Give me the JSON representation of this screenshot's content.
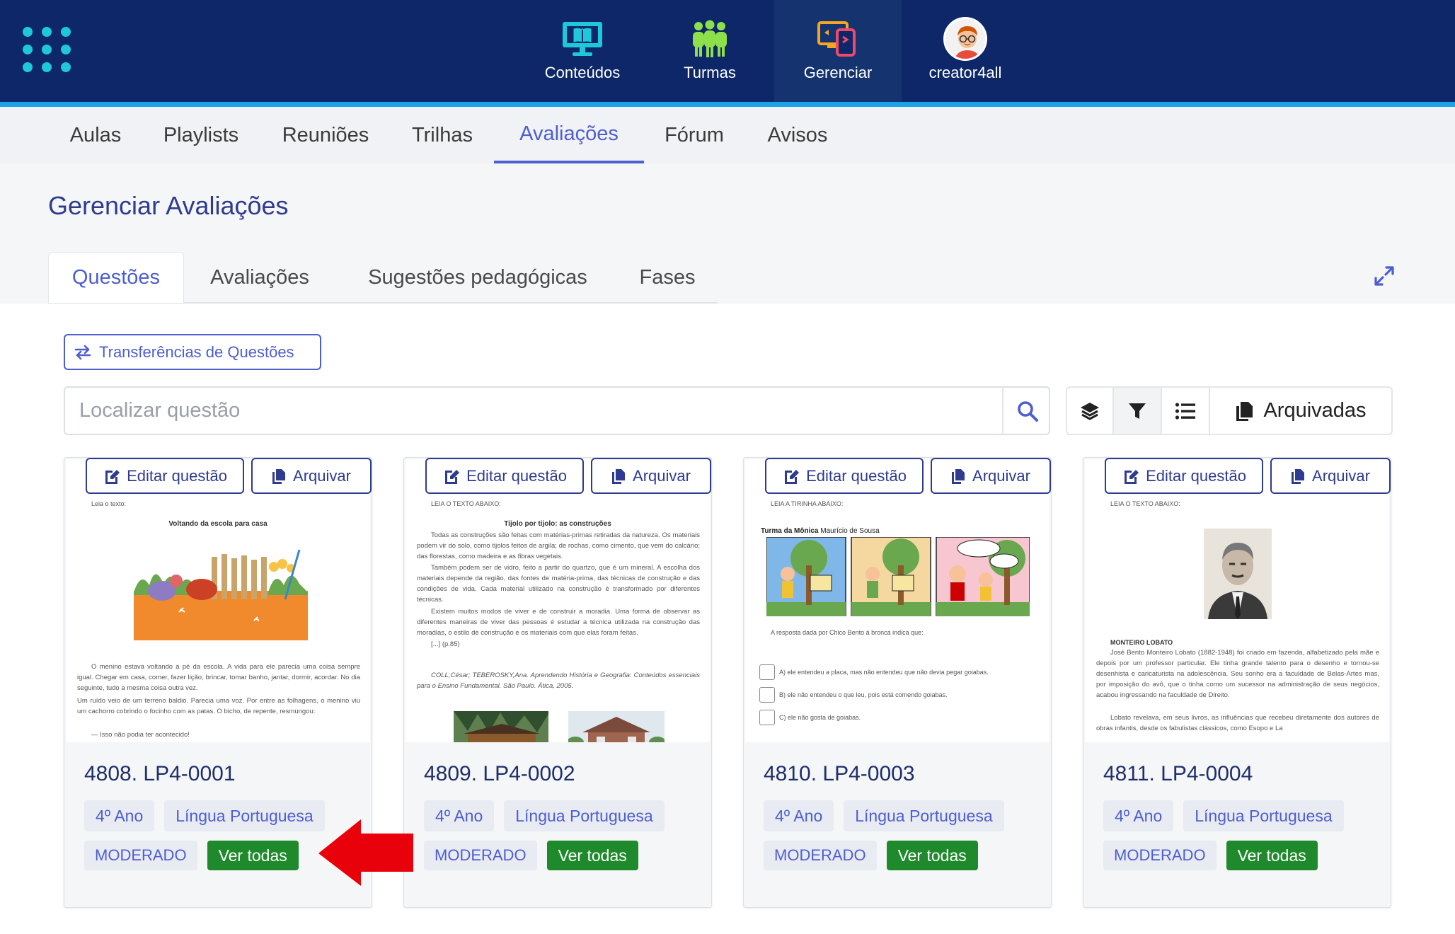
{
  "topnav": {
    "items": [
      {
        "label": "Conteúdos",
        "icon": "monitor-icon"
      },
      {
        "label": "Turmas",
        "icon": "people-icon"
      },
      {
        "label": "Gerenciar",
        "icon": "devices-icon",
        "active": true
      },
      {
        "label": "creator4all",
        "icon": "avatar"
      }
    ]
  },
  "subnav": {
    "items": [
      "Aulas",
      "Playlists",
      "Reuniões",
      "Trilhas",
      "Avaliações",
      "Fórum",
      "Avisos"
    ],
    "active": "Avaliações"
  },
  "page": {
    "title": "Gerenciar Avaliações",
    "tabs": [
      "Questões",
      "Avaliações",
      "Sugestões pedagógicas",
      "Fases"
    ],
    "active_tab": "Questões"
  },
  "transfer_button": {
    "label": "Transferências de Questões",
    "icon": "swap-icon"
  },
  "search": {
    "placeholder": "Localizar questão",
    "value": ""
  },
  "toolbar": {
    "archived_label": "Arquivadas"
  },
  "card_buttons": {
    "edit": "Editar questão",
    "archive": "Arquivar",
    "view_all": "Ver todas"
  },
  "cards": [
    {
      "code": "4808. LP4-0001",
      "grade": "4º Ano",
      "subject": "Língua Portuguesa",
      "status": "MODERADO",
      "preview": {
        "heading": "Leia o texto:",
        "title": "Voltando da escola para casa",
        "para1": "O menino estava voltando a pé da escola. A vida para ele parecia uma coisa sempre igual. Chegar em casa, comer, fazer lição, brincar, tomar banho, jantar, dormir, acordar. No dia seguinte, tudo a mesma coisa outra vez.",
        "para2": "Um ruído veio de um terreno baldio. Parecia uma voz. Por entre as folhagens, o menino viu um cachorro cobrindo o focinho com as patas. O bicho, de repente, resmungou:",
        "para3": "— Isso não podia ter acontecido!"
      }
    },
    {
      "code": "4809. LP4-0002",
      "grade": "4º Ano",
      "subject": "Língua Portuguesa",
      "status": "MODERADO",
      "preview": {
        "heading": "LEIA O TEXTO ABAIXO:",
        "title": "Tijolo por tijolo: as construções",
        "para1": "Todas as construções são feitas com matérias-primas retiradas da natureza. Os materiais podem vir do solo, como tijolos feitos de argila; de rochas, como cimento, que vem do calcário; das florestas, como madeira e as fibras vegetais.",
        "para2": "Também podem ser de vidro, feito a partir do quartzo, que é um mineral. A escolha dos materiais depende da região, das fontes de matéria-prima, das técnicas de construção e das condições de vida. Cada material utilizado na construção é transformado por diferentes técnicas.",
        "para3": "Existem muitos modos de viver e de construir a moradia. Uma forma de observar as diferentes maneiras de viver das pessoas é estudar a técnica utilizada na construção das moradias, o estilo de construção e os materiais com que elas foram feitas.",
        "para4": "[...] (p.85)",
        "citation": "COLL,César; TEBEROSKY,Ana. Aprendendo História e Geografia: Conteúdos essenciais para o Ensino Fundamental. São Paulo. Ática, 2005."
      }
    },
    {
      "code": "4810. LP4-0003",
      "grade": "4º Ano",
      "subject": "Língua Portuguesa",
      "status": "MODERADO",
      "preview": {
        "heading": "LEIA A TIRINHA ABAIXO:",
        "comic_title_bold": "Turma da Mônica",
        "comic_title_author": "Maurício de Sousa",
        "question": "A resposta dada por Chico Bento à bronca indica que:",
        "optA": "A) ele entendeu a placa, mas não entendeu que não devia pegar goiabas.",
        "optB": "B) ele não entendeu o que leu, pois está comendo goiabas.",
        "optC": "C) ele não gosta de goiabas."
      }
    },
    {
      "code": "4811. LP4-0004",
      "grade": "4º Ano",
      "subject": "Língua Portuguesa",
      "status": "MODERADO",
      "preview": {
        "heading": "LEIA O TEXTO ABAIXO:",
        "name": "MONTEIRO LOBATO",
        "para1": "José Bento Monteiro Lobato (1882-1948) foi criado em fazenda, alfabetizado pela mãe e depois por um professor particular. Ele tinha grande talento para o desenho e tornou-se desenhista e caricaturista na adolescência. Seu sonho era a faculdade de Belas-Artes mas, por imposição do avô, que o tinha como um sucessor na administração de seus negócios, acabou ingressando na faculdade de Direito.",
        "para2": "Lobato revelava, em seus livros, as influências que recebeu diretamente dos autores de obras infantis, desde os fabulistas clássicos, como Esopo e La"
      }
    }
  ],
  "colors": {
    "topbar": "#0d2769",
    "accent_bar": "#1aa3e8",
    "primary": "#4d5ed0",
    "title": "#2e3b8f",
    "success": "#1f8a2c",
    "annotation_arrow": "#e8000b"
  }
}
